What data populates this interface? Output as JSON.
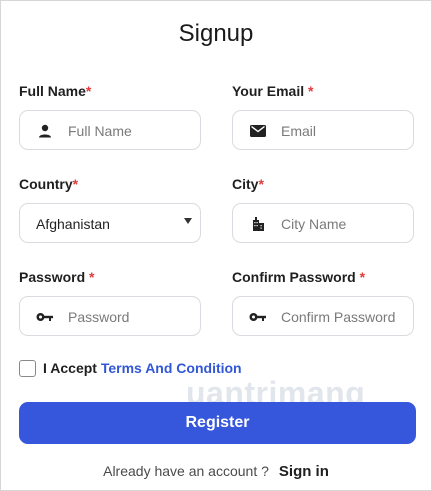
{
  "form": {
    "title": "Signup",
    "full_name": {
      "label": "Full Name",
      "required": "*",
      "placeholder": "Full Name",
      "icon": "person-icon"
    },
    "email": {
      "label": "Your Email ",
      "required": "*",
      "placeholder": "Email",
      "icon": "envelope-icon"
    },
    "country": {
      "label": "Country",
      "required": "*",
      "value": "Afghanistan",
      "icon": "chevron-down-icon"
    },
    "city": {
      "label": "City",
      "required": "*",
      "placeholder": "City Name",
      "icon": "building-icon"
    },
    "password": {
      "label": "Password ",
      "required": "*",
      "placeholder": "Password",
      "icon": "key-icon"
    },
    "confirm_password": {
      "label": "Confirm Password ",
      "required": "*",
      "placeholder": "Confirm Password",
      "icon": "key-icon"
    },
    "terms": {
      "prefix": "I Accept ",
      "link": "Terms And Condition",
      "checked": false
    },
    "register_label": "Register",
    "footer": {
      "question": "Already have an account ?",
      "signin": "Sign in"
    }
  },
  "watermark": {
    "text": "uantrimang"
  },
  "colors": {
    "accent": "#3656dc",
    "link": "#3257d6",
    "required": "#e23b3b",
    "border": "#d9dbe0"
  }
}
